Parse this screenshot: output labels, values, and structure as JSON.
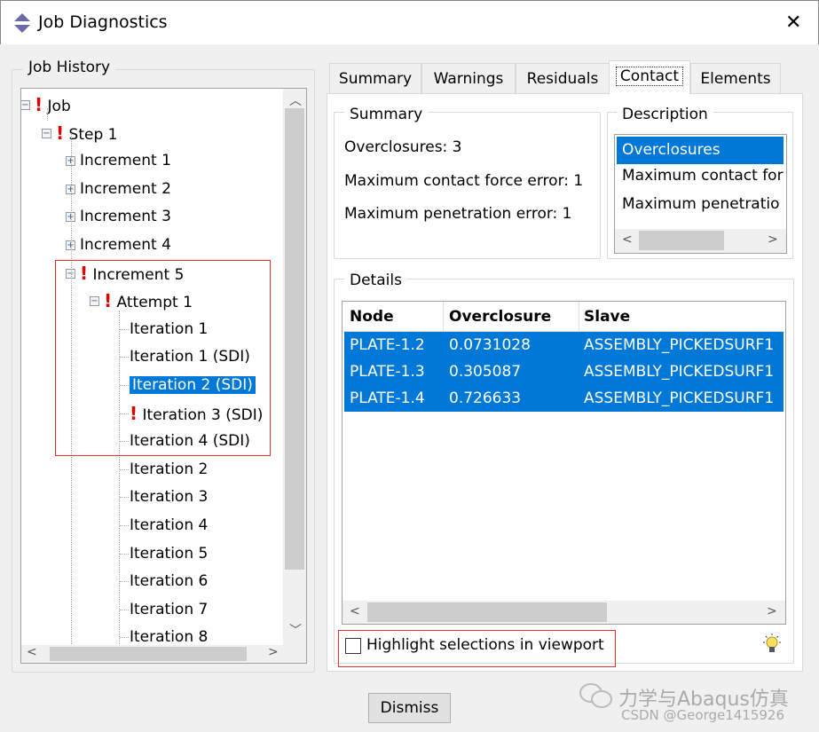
{
  "window": {
    "title": "Job Diagnostics",
    "icon": "abaqus-logo-icon",
    "close": "✕"
  },
  "job_history": {
    "label": "Job History",
    "nodes": [
      {
        "label": "Job",
        "level": 0,
        "toggle": "minus",
        "warn": true
      },
      {
        "label": "Step 1",
        "level": 1,
        "toggle": "minus",
        "warn": true
      },
      {
        "label": "Increment 1",
        "level": 2,
        "toggle": "plus",
        "warn": false
      },
      {
        "label": "Increment 2",
        "level": 2,
        "toggle": "plus",
        "warn": false
      },
      {
        "label": "Increment 3",
        "level": 2,
        "toggle": "plus",
        "warn": false
      },
      {
        "label": "Increment 4",
        "level": 2,
        "toggle": "plus",
        "warn": false
      },
      {
        "label": "Increment 5",
        "level": 2,
        "toggle": "minus",
        "warn": true
      },
      {
        "label": "Attempt 1",
        "level": 3,
        "toggle": "minus",
        "warn": true
      },
      {
        "label": "Iteration 1",
        "level": 4,
        "warn": false
      },
      {
        "label": "Iteration 1 (SDI)",
        "level": 4,
        "warn": false
      },
      {
        "label": "Iteration 2 (SDI)",
        "level": 4,
        "warn": false,
        "selected": true
      },
      {
        "label": "Iteration 3 (SDI)",
        "level": 4,
        "warn": true
      },
      {
        "label": "Iteration 4 (SDI)",
        "level": 4,
        "warn": false
      },
      {
        "label": "Iteration 2",
        "level": 4,
        "warn": false
      },
      {
        "label": "Iteration 3",
        "level": 4,
        "warn": false
      },
      {
        "label": "Iteration 4",
        "level": 4,
        "warn": false
      },
      {
        "label": "Iteration 5",
        "level": 4,
        "warn": false
      },
      {
        "label": "Iteration 6",
        "level": 4,
        "warn": false
      },
      {
        "label": "Iteration 7",
        "level": 4,
        "warn": false
      },
      {
        "label": "Iteration 8",
        "level": 4,
        "warn": false
      }
    ]
  },
  "tabs": [
    {
      "label": "Summary"
    },
    {
      "label": "Warnings"
    },
    {
      "label": "Residuals"
    },
    {
      "label": "Contact",
      "active": true
    },
    {
      "label": "Elements"
    }
  ],
  "summary": {
    "label": "Summary",
    "lines": [
      "Overclosures: 3",
      "Maximum contact force error: 1",
      "Maximum penetration error: 1"
    ]
  },
  "description": {
    "label": "Description",
    "items": [
      "Overclosures",
      "Maximum contact for",
      "Maximum penetratio"
    ],
    "selected_index": 0
  },
  "details": {
    "label": "Details",
    "columns": [
      "Node",
      "Overclosure",
      "Slave"
    ],
    "rows": [
      [
        "PLATE-1.2",
        "0.0731028",
        "ASSEMBLY_PICKEDSURF1"
      ],
      [
        "PLATE-1.3",
        "0.305087",
        "ASSEMBLY_PICKEDSURF1"
      ],
      [
        "PLATE-1.4",
        "0.726633",
        "ASSEMBLY_PICKEDSURF1"
      ]
    ]
  },
  "highlight": {
    "label": "Highlight selections in viewport",
    "checked": false
  },
  "tip_icon": "lightbulb-icon",
  "dismiss": "Dismiss",
  "watermark": {
    "line1": "力学与Abaqus仿真",
    "line2": "CSDN @George1415926"
  },
  "colors": {
    "selection": "#0078d7",
    "warning": "#e00000",
    "annotation": "#e53030"
  }
}
